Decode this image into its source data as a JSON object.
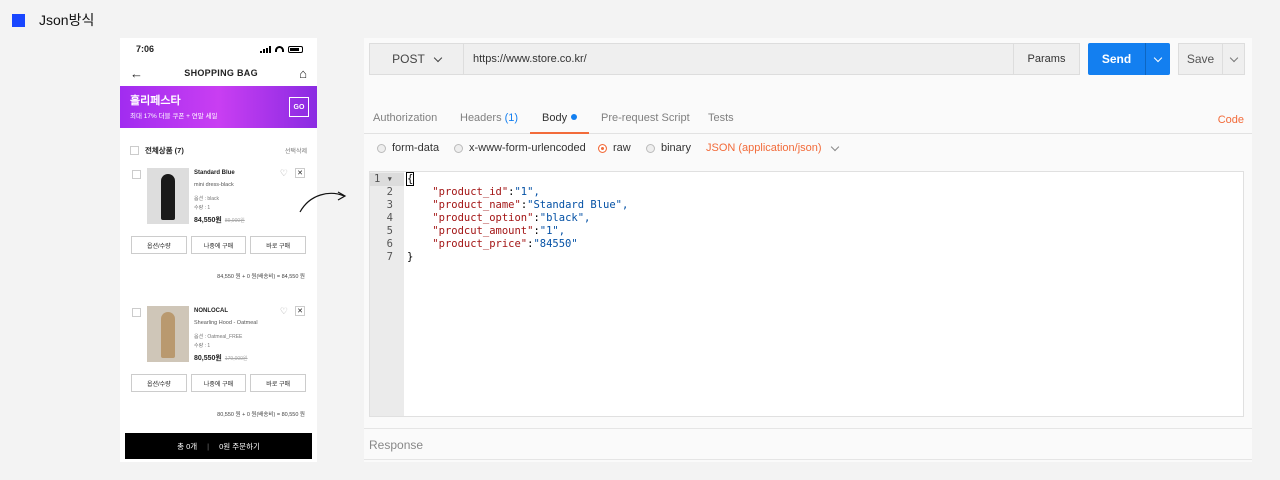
{
  "slide": {
    "title": "Json방식",
    "accent_color": "#1846ff"
  },
  "phone": {
    "time": "7:06",
    "header_title": "SHOPPING BAG",
    "banner": {
      "title": "홀리페스타",
      "subtitle": "최대 17% 더블 쿠폰 + 연말 세일",
      "go": "GO"
    },
    "select_all": "전체상품 (7)",
    "delete_selected": "선택삭제",
    "items": [
      {
        "name": "Standard Blue",
        "subtitle": "mini dress-black",
        "option": "옵션 : black",
        "qty": "수량 : 1",
        "price": "84,550원",
        "original_price": "89,000원",
        "buttons": [
          "옵션/수량",
          "나중에 구매",
          "바로 구매"
        ],
        "total": "84,550 원 + 0 원(배송비) = 84,550 원",
        "figure_color": "#1a1a1a"
      },
      {
        "name": "NONLOCAL",
        "subtitle": "Shearling Hood - Oatmeal",
        "option": "옵션 : Oatmeal_FREE",
        "qty": "수량 : 1",
        "price": "80,550원",
        "original_price": "179,000원",
        "buttons": [
          "옵션/수량",
          "나중에 구매",
          "바로 구매"
        ],
        "total": "80,550 원 + 0 원(배송비) = 80,550 원",
        "figure_color": "#b9996f"
      }
    ],
    "order_bar": {
      "count": "총 0개",
      "sep": "|",
      "action": "0원 주문하기"
    }
  },
  "postman": {
    "method": "POST",
    "url": "https://www.store.co.kr/",
    "params_label": "Params",
    "send_label": "Send",
    "save_label": "Save",
    "tabs": [
      {
        "label": "Authorization"
      },
      {
        "label": "Headers",
        "count": "(1)"
      },
      {
        "label": "Body"
      },
      {
        "label": "Pre-request Script"
      },
      {
        "label": "Tests"
      }
    ],
    "code_link": "Code",
    "body_types": [
      "form-data",
      "x-www-form-urlencoded",
      "raw",
      "binary"
    ],
    "selected_body_type": "raw",
    "content_type": "JSON (application/json)",
    "line_numbers": [
      "1",
      "2",
      "3",
      "4",
      "5",
      "6",
      "7"
    ],
    "code": {
      "open": "{",
      "close": "}",
      "pairs": [
        {
          "key": "\"product_id\"",
          "value": "\"1\","
        },
        {
          "key": "\"product_name\"",
          "value": "\"Standard Blue\","
        },
        {
          "key": "\"product_option\"",
          "value": "\"black\","
        },
        {
          "key": "\"prodcut_amount\"",
          "value": "\"1\","
        },
        {
          "key": "\"product_price\"",
          "value": "\"84550\""
        }
      ]
    },
    "response_label": "Response",
    "accent_color": "#f26b3a",
    "send_color": "#137ff0"
  }
}
